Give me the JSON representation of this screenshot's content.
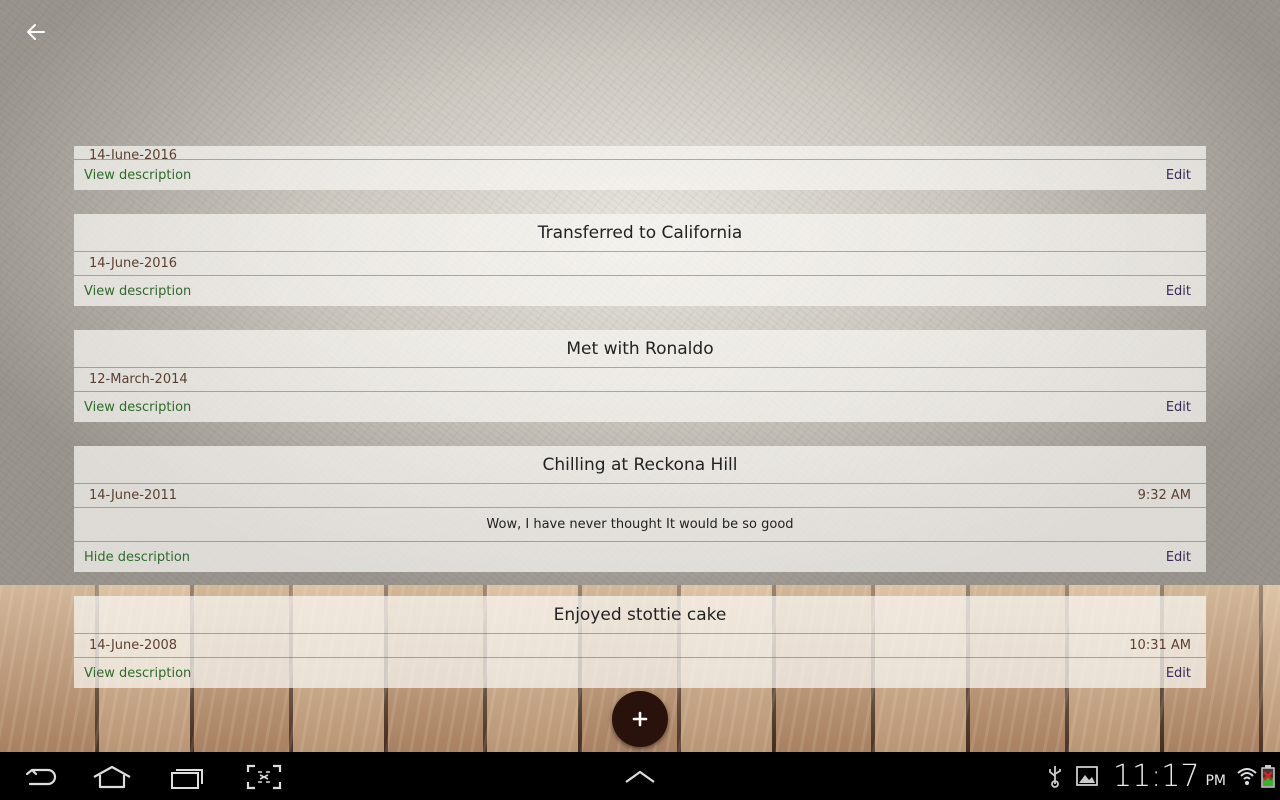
{
  "toolbar": {
    "back_icon": "arrow-left-icon"
  },
  "entries": [
    {
      "title": "",
      "date": "14-June-2016",
      "time": "",
      "description": "",
      "toggle_label": "View description",
      "edit_label": "Edit"
    },
    {
      "title": "Transferred to California",
      "date": "14-June-2016",
      "time": "",
      "description": "",
      "toggle_label": "View description",
      "edit_label": "Edit"
    },
    {
      "title": "Met with Ronaldo",
      "date": "12-March-2014",
      "time": "",
      "description": "",
      "toggle_label": "View description",
      "edit_label": "Edit"
    },
    {
      "title": "Chilling at Reckona Hill",
      "date": "14-June-2011",
      "time": "9:32 AM",
      "description": "Wow, I have never thought It would be so good",
      "toggle_label": "Hide description",
      "edit_label": "Edit"
    },
    {
      "title": "Enjoyed stottie cake",
      "date": "14-June-2008",
      "time": "10:31 AM",
      "description": "",
      "toggle_label": "View description",
      "edit_label": "Edit"
    }
  ],
  "fab": {
    "icon": "plus-icon"
  },
  "system_bar": {
    "time": "11:17",
    "ampm": "PM",
    "icons": [
      "nav-back-icon",
      "nav-home-icon",
      "recent-apps-icon",
      "screenshot-icon",
      "chevron-up-icon",
      "usb-icon",
      "image-icon",
      "wifi-icon",
      "battery-icon"
    ]
  },
  "colors": {
    "link_green": "#2e6b2a",
    "edit_purple": "#3a2a55",
    "fab": "#2a120c"
  }
}
